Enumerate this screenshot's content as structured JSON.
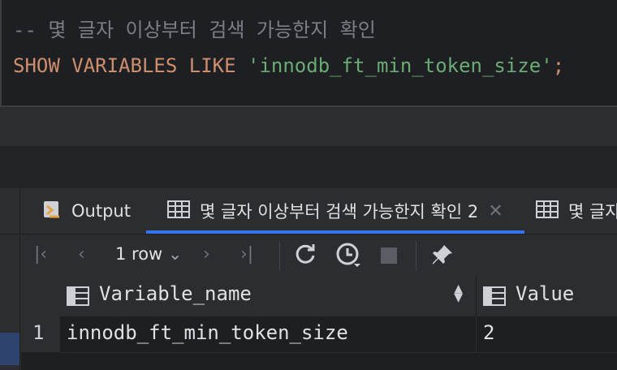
{
  "editor": {
    "comment": "-- 몇 글자 이상부터 검색 가능한지 확인",
    "kw_show": "SHOW",
    "kw_variables": "VARIABLES",
    "kw_like": "LIKE",
    "string_literal": "'innodb_ft_min_token_size'",
    "terminator": ";"
  },
  "tabs": [
    {
      "label": "Output",
      "icon": "output-icon"
    },
    {
      "label": "몇 글자 이상부터 검색 가능한지 확인 2",
      "icon": "table-icon"
    },
    {
      "label": "몇 글자",
      "icon": "table-icon"
    }
  ],
  "toolbar": {
    "rows_label": "1 row",
    "rows_chevron": "⌄"
  },
  "grid": {
    "columns": [
      {
        "label": "Variable_name"
      },
      {
        "label": "Value"
      }
    ],
    "rows": [
      {
        "num": "1",
        "cells": [
          "innodb_ft_min_token_size",
          "2"
        ]
      }
    ]
  },
  "colors": {
    "keyword": "#cf8e6d",
    "string": "#6aab73",
    "comment": "#7a7e85",
    "accent": "#3574f0"
  }
}
